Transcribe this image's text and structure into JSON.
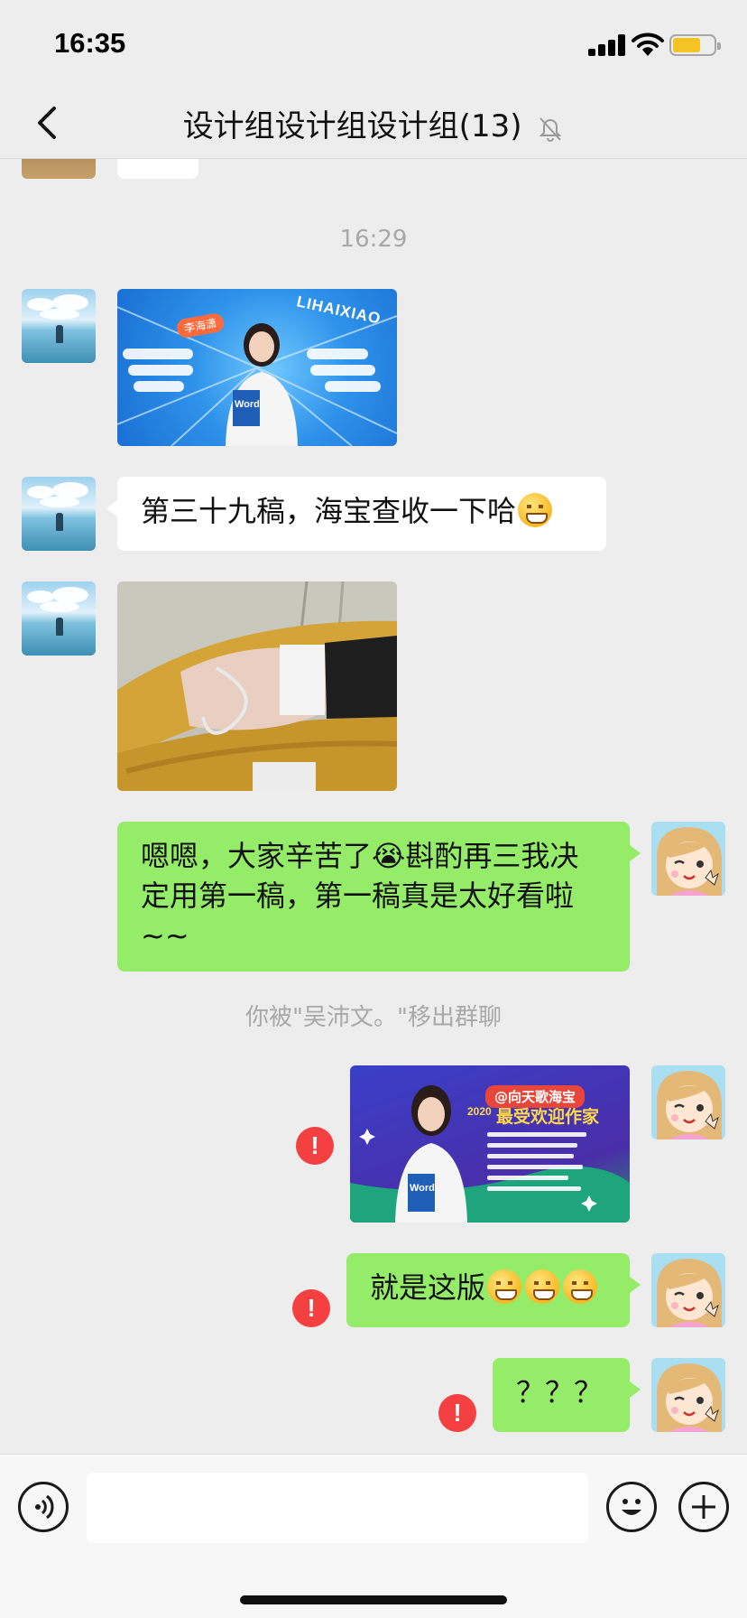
{
  "status_bar": {
    "time": "16:35"
  },
  "nav": {
    "title": "设计组设计组设计组(13)"
  },
  "messages": {
    "timestamp": "16:29",
    "poster1": {
      "banner": "LIHAIXIAO",
      "tag": "李海潇",
      "book": "Word"
    },
    "text1": "第三十九稿，海宝查收一下哈",
    "reply1": "嗯嗯，大家辛苦了😭斟酌再三我决定用第一稿，第一稿真是太好看啦~~",
    "system": "你被\"吴沛文。\"移出群聊",
    "poster2": {
      "badge": "@向天歌海宝",
      "year": "2020",
      "headline": "最受欢迎作家",
      "book": "Word"
    },
    "reply2": "就是这版",
    "reply3": "？？？",
    "error_glyph": "!"
  },
  "input": {
    "placeholder": ""
  },
  "icons": {
    "back": "chevron-left-icon",
    "mute": "bell-slash-icon",
    "voice": "voice-icon",
    "emoji": "emoji-icon",
    "plus": "plus-icon",
    "error": "error-icon"
  },
  "colors": {
    "bubble_green": "#95ec69",
    "bubble_white": "#ffffff",
    "error_red": "#f44040",
    "background": "#ededed"
  }
}
